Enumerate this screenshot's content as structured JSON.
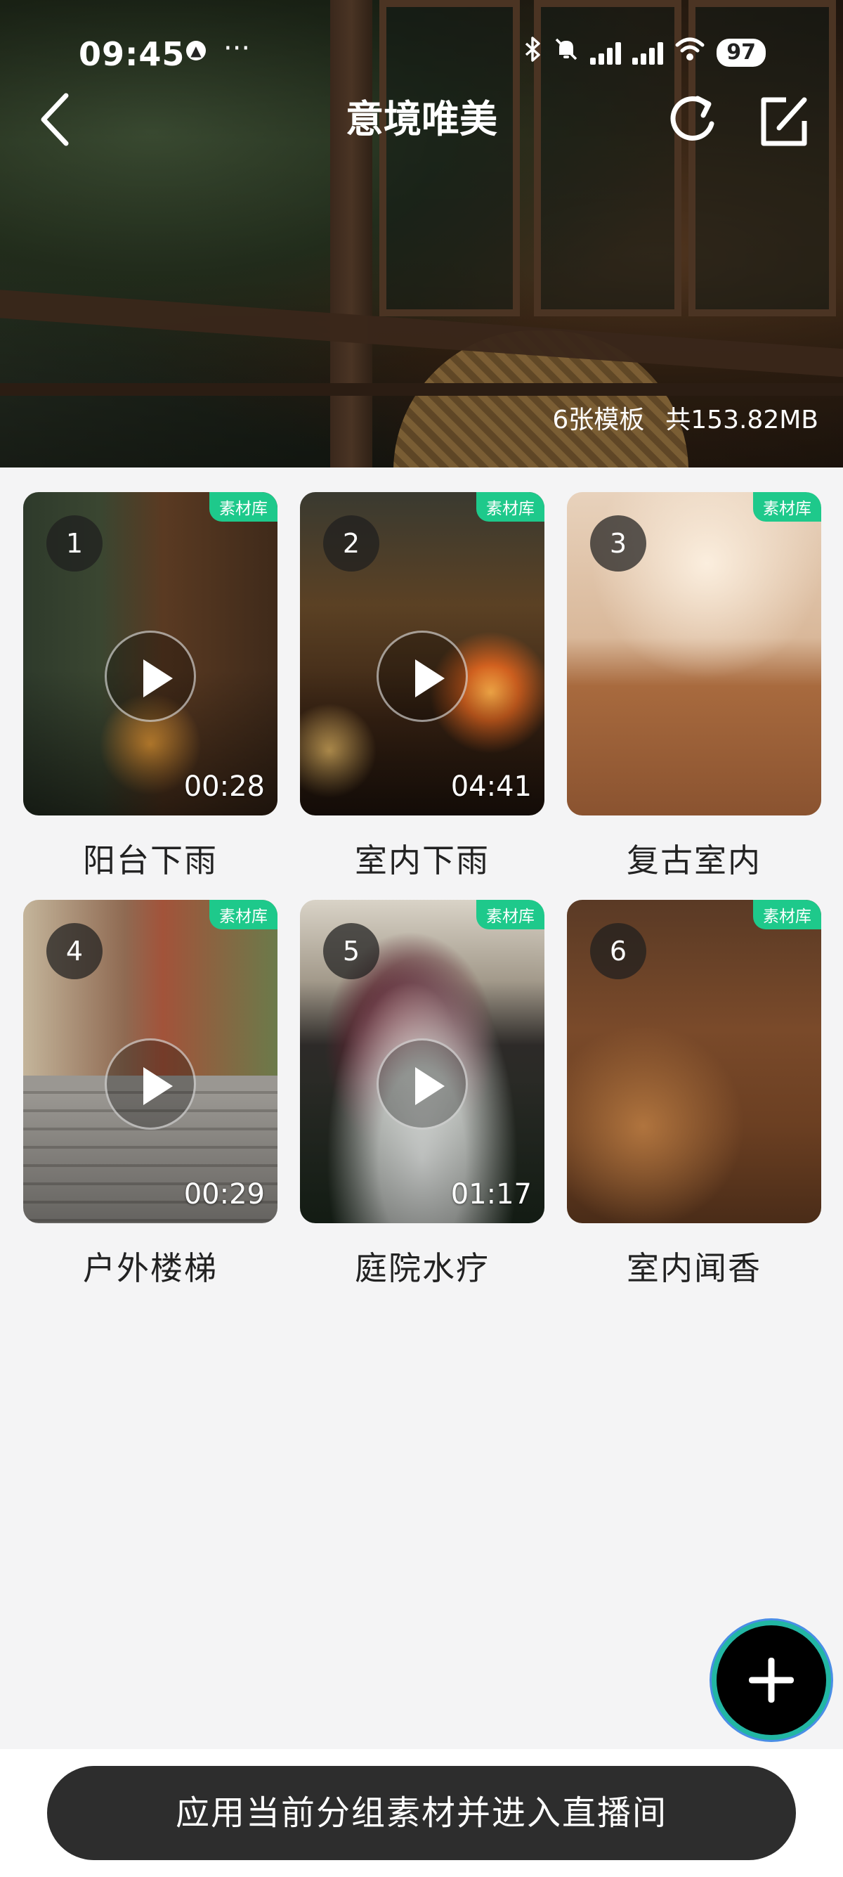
{
  "status_bar": {
    "time": "09:45",
    "more": "···",
    "battery": "97",
    "icons": [
      "bluetooth-icon",
      "mute-icon",
      "signal-icon",
      "signal-icon",
      "wifi-icon"
    ]
  },
  "nav": {
    "title": "意境唯美",
    "back_icon": "chevron-left-icon",
    "refresh_icon": "refresh-icon",
    "edit_icon": "edit-icon"
  },
  "hero": {
    "count_text": "6张模板",
    "size_text": "共153.82MB"
  },
  "items": [
    {
      "index": "1",
      "tag": "素材库",
      "duration": "00:28",
      "label": "阳台下雨",
      "has_play": true
    },
    {
      "index": "2",
      "tag": "素材库",
      "duration": "04:41",
      "label": "室内下雨",
      "has_play": true
    },
    {
      "index": "3",
      "tag": "素材库",
      "duration": "",
      "label": "复古室内",
      "has_play": false
    },
    {
      "index": "4",
      "tag": "素材库",
      "duration": "00:29",
      "label": "户外楼梯",
      "has_play": true
    },
    {
      "index": "5",
      "tag": "素材库",
      "duration": "01:17",
      "label": "庭院水疗",
      "has_play": true
    },
    {
      "index": "6",
      "tag": "素材库",
      "duration": "",
      "label": "室内闻香",
      "has_play": false
    }
  ],
  "fab_icon": "plus-icon",
  "apply_button": "应用当前分组素材并进入直播间",
  "colors": {
    "tag_green": "#1ec98b",
    "button_dark": "#2d2d2d",
    "fab_ring": "#22b6a3"
  }
}
